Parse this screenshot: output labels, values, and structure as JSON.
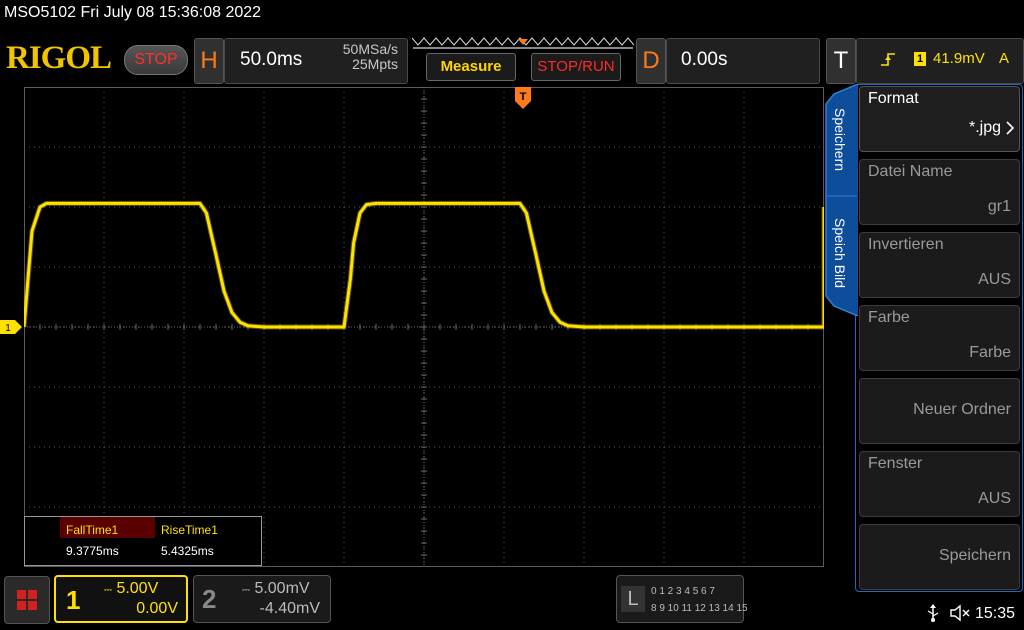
{
  "title": "MSO5102  Fri July 08 15:36:08 2022",
  "header": {
    "logo": "RIGOL",
    "run_state": "STOP",
    "horizontal": {
      "letter": "H",
      "timebase": "50.0ms",
      "sample_rate": "50MSa/s",
      "memory_depth": "25Mpts"
    },
    "measure_label": "Measure",
    "stoprun_label": "STOP/RUN",
    "delay": {
      "letter": "D",
      "value": "0.00s"
    },
    "trigger": {
      "letter": "T",
      "channel": "1",
      "level": "41.9mV",
      "mode": "A",
      "edge_icon": "rising-edge-icon"
    }
  },
  "display": {
    "grid": {
      "divisions_x": 10,
      "divisions_y": 8
    },
    "channel1_marker": "1",
    "trigger_marker": "T",
    "ch1_color": "#ffe100",
    "accent_orange": "#ff7a1a"
  },
  "chart_data": {
    "type": "line",
    "title": "",
    "xlabel": "",
    "ylabel": "",
    "xlim": [
      -250,
      250
    ],
    "ylim": [
      -20,
      20
    ],
    "series": [
      {
        "color": "#ffe100",
        "x": [
          -250,
          -245,
          -240,
          -236,
          -230,
          -140,
          -136,
          -130,
          -125,
          -120,
          -115,
          -110,
          -100,
          -50,
          -46,
          -44,
          -40,
          -36,
          -30,
          60,
          64,
          70,
          75,
          80,
          85,
          90,
          100,
          150
        ],
        "y": [
          0,
          8,
          10,
          10.3,
          10.3,
          10.3,
          9.5,
          6,
          3,
          1.2,
          0.4,
          0.1,
          0,
          0,
          4,
          7,
          9.5,
          10.2,
          10.3,
          10.3,
          9.5,
          6,
          3,
          1.2,
          0.4,
          0.1,
          0,
          0
        ]
      }
    ]
  },
  "measurements": [
    {
      "name": "FallTime1",
      "value": "9.3775ms"
    },
    {
      "name": "RiseTime1",
      "value": "5.4325ms"
    }
  ],
  "side_menu": {
    "tabs": [
      "Speichern",
      "Speich Bild"
    ],
    "items": [
      {
        "label": "Format",
        "value": "*.jpg"
      },
      {
        "label": "Datei Name",
        "value": "gr1"
      },
      {
        "label": "Invertieren",
        "value": "AUS"
      },
      {
        "label": "Farbe",
        "value": "Farbe"
      },
      {
        "label": "",
        "value": "Neuer Ordner"
      },
      {
        "label": "Fenster",
        "value": "AUS"
      },
      {
        "label": "",
        "value": "Speichern"
      }
    ]
  },
  "bottom": {
    "ch1": {
      "num": "1",
      "scale": "5.00V",
      "offset": "0.00V",
      "coupling": "DC"
    },
    "ch2": {
      "num": "2",
      "scale": "5.00mV",
      "offset": "-4.40mV",
      "coupling": "DC"
    },
    "la": {
      "letter": "L",
      "row1": "0 1 2 3   4 5 6 7",
      "row2": "8 9 10 11  12 13 14 15"
    },
    "clock": "15:35"
  }
}
